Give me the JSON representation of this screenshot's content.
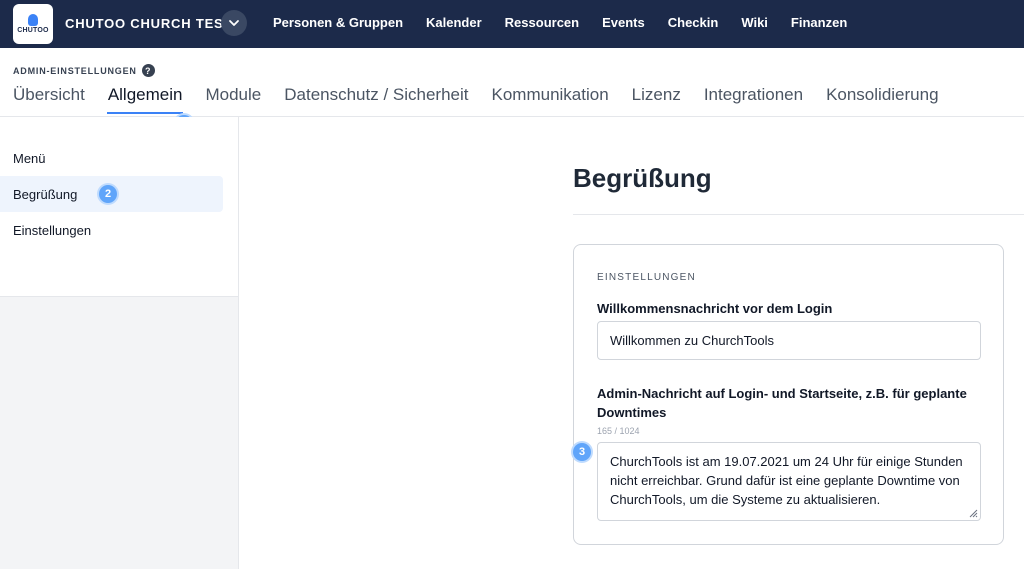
{
  "topbar": {
    "logo_text": "CHUTOO",
    "app_title": "CHUTOO CHURCH TEST",
    "nav": [
      "Personen & Gruppen",
      "Kalender",
      "Ressourcen",
      "Events",
      "Checkin",
      "Wiki",
      "Finanzen"
    ],
    "bg_color": "#1c2a4a"
  },
  "header": {
    "breadcrumb": "ADMIN-EINSTELLUNGEN",
    "help_icon": "?",
    "tabs": [
      "Übersicht",
      "Allgemein",
      "Module",
      "Datenschutz / Sicherheit",
      "Kommunikation",
      "Lizenz",
      "Integrationen",
      "Konsolidierung"
    ],
    "active_tab": "Allgemein"
  },
  "sidebar": {
    "items": [
      "Menü",
      "Begrüßung",
      "Einstellungen"
    ],
    "active_item": "Begrüßung"
  },
  "main": {
    "title": "Begrüßung",
    "card": {
      "header": "EINSTELLUNGEN",
      "welcome_label": "Willkommensnachricht vor dem Login",
      "welcome_value": "Willkommen zu ChurchTools",
      "admin_label": "Admin-Nachricht auf Login- und Startseite, z.B. für geplante Downtimes",
      "admin_counter": "165 / 1024",
      "admin_value": "ChurchTools ist am 19.07.2021 um 24 Uhr für einige Stunden nicht erreichbar. Grund dafür ist eine geplante Downtime von ChurchTools, um die Systeme zu aktualisieren."
    }
  },
  "markers": [
    "1",
    "2",
    "3"
  ],
  "accent_color": "#3b82f6"
}
